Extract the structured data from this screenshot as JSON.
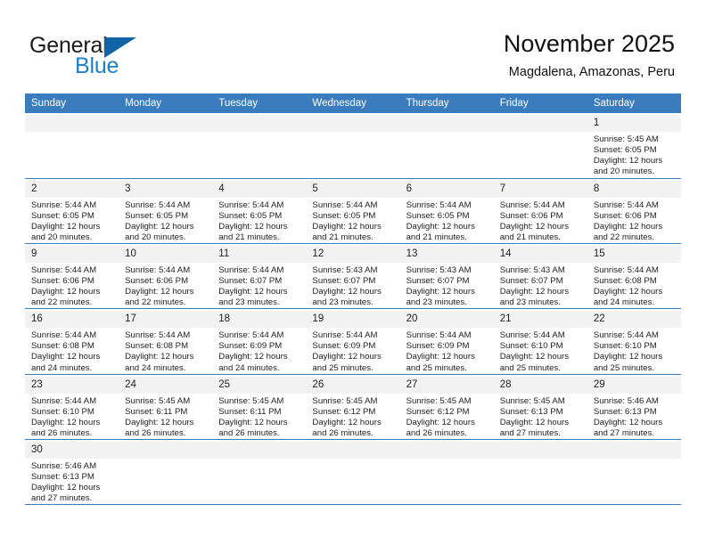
{
  "brand": {
    "name_part1": "General",
    "name_part2": "Blue",
    "triangle_color": "#1063a5",
    "blue_color": "#1e7ec8"
  },
  "header": {
    "month_title": "November 2025",
    "location": "Magdalena, Amazonas, Peru"
  },
  "theme": {
    "header_blue": "#3a7cbe",
    "cell_shade": "#f2f2f2"
  },
  "weekdays": [
    "Sunday",
    "Monday",
    "Tuesday",
    "Wednesday",
    "Thursday",
    "Friday",
    "Saturday"
  ],
  "weeks": [
    [
      {
        "day": "",
        "lines": []
      },
      {
        "day": "",
        "lines": []
      },
      {
        "day": "",
        "lines": []
      },
      {
        "day": "",
        "lines": []
      },
      {
        "day": "",
        "lines": []
      },
      {
        "day": "",
        "lines": []
      },
      {
        "day": "1",
        "lines": [
          "Sunrise: 5:45 AM",
          "Sunset: 6:05 PM",
          "Daylight: 12 hours",
          "and 20 minutes."
        ]
      }
    ],
    [
      {
        "day": "2",
        "lines": [
          "Sunrise: 5:44 AM",
          "Sunset: 6:05 PM",
          "Daylight: 12 hours",
          "and 20 minutes."
        ]
      },
      {
        "day": "3",
        "lines": [
          "Sunrise: 5:44 AM",
          "Sunset: 6:05 PM",
          "Daylight: 12 hours",
          "and 20 minutes."
        ]
      },
      {
        "day": "4",
        "lines": [
          "Sunrise: 5:44 AM",
          "Sunset: 6:05 PM",
          "Daylight: 12 hours",
          "and 21 minutes."
        ]
      },
      {
        "day": "5",
        "lines": [
          "Sunrise: 5:44 AM",
          "Sunset: 6:05 PM",
          "Daylight: 12 hours",
          "and 21 minutes."
        ]
      },
      {
        "day": "6",
        "lines": [
          "Sunrise: 5:44 AM",
          "Sunset: 6:05 PM",
          "Daylight: 12 hours",
          "and 21 minutes."
        ]
      },
      {
        "day": "7",
        "lines": [
          "Sunrise: 5:44 AM",
          "Sunset: 6:06 PM",
          "Daylight: 12 hours",
          "and 21 minutes."
        ]
      },
      {
        "day": "8",
        "lines": [
          "Sunrise: 5:44 AM",
          "Sunset: 6:06 PM",
          "Daylight: 12 hours",
          "and 22 minutes."
        ]
      }
    ],
    [
      {
        "day": "9",
        "lines": [
          "Sunrise: 5:44 AM",
          "Sunset: 6:06 PM",
          "Daylight: 12 hours",
          "and 22 minutes."
        ]
      },
      {
        "day": "10",
        "lines": [
          "Sunrise: 5:44 AM",
          "Sunset: 6:06 PM",
          "Daylight: 12 hours",
          "and 22 minutes."
        ]
      },
      {
        "day": "11",
        "lines": [
          "Sunrise: 5:44 AM",
          "Sunset: 6:07 PM",
          "Daylight: 12 hours",
          "and 23 minutes."
        ]
      },
      {
        "day": "12",
        "lines": [
          "Sunrise: 5:43 AM",
          "Sunset: 6:07 PM",
          "Daylight: 12 hours",
          "and 23 minutes."
        ]
      },
      {
        "day": "13",
        "lines": [
          "Sunrise: 5:43 AM",
          "Sunset: 6:07 PM",
          "Daylight: 12 hours",
          "and 23 minutes."
        ]
      },
      {
        "day": "14",
        "lines": [
          "Sunrise: 5:43 AM",
          "Sunset: 6:07 PM",
          "Daylight: 12 hours",
          "and 23 minutes."
        ]
      },
      {
        "day": "15",
        "lines": [
          "Sunrise: 5:44 AM",
          "Sunset: 6:08 PM",
          "Daylight: 12 hours",
          "and 24 minutes."
        ]
      }
    ],
    [
      {
        "day": "16",
        "lines": [
          "Sunrise: 5:44 AM",
          "Sunset: 6:08 PM",
          "Daylight: 12 hours",
          "and 24 minutes."
        ]
      },
      {
        "day": "17",
        "lines": [
          "Sunrise: 5:44 AM",
          "Sunset: 6:08 PM",
          "Daylight: 12 hours",
          "and 24 minutes."
        ]
      },
      {
        "day": "18",
        "lines": [
          "Sunrise: 5:44 AM",
          "Sunset: 6:09 PM",
          "Daylight: 12 hours",
          "and 24 minutes."
        ]
      },
      {
        "day": "19",
        "lines": [
          "Sunrise: 5:44 AM",
          "Sunset: 6:09 PM",
          "Daylight: 12 hours",
          "and 25 minutes."
        ]
      },
      {
        "day": "20",
        "lines": [
          "Sunrise: 5:44 AM",
          "Sunset: 6:09 PM",
          "Daylight: 12 hours",
          "and 25 minutes."
        ]
      },
      {
        "day": "21",
        "lines": [
          "Sunrise: 5:44 AM",
          "Sunset: 6:10 PM",
          "Daylight: 12 hours",
          "and 25 minutes."
        ]
      },
      {
        "day": "22",
        "lines": [
          "Sunrise: 5:44 AM",
          "Sunset: 6:10 PM",
          "Daylight: 12 hours",
          "and 25 minutes."
        ]
      }
    ],
    [
      {
        "day": "23",
        "lines": [
          "Sunrise: 5:44 AM",
          "Sunset: 6:10 PM",
          "Daylight: 12 hours",
          "and 26 minutes."
        ]
      },
      {
        "day": "24",
        "lines": [
          "Sunrise: 5:45 AM",
          "Sunset: 6:11 PM",
          "Daylight: 12 hours",
          "and 26 minutes."
        ]
      },
      {
        "day": "25",
        "lines": [
          "Sunrise: 5:45 AM",
          "Sunset: 6:11 PM",
          "Daylight: 12 hours",
          "and 26 minutes."
        ]
      },
      {
        "day": "26",
        "lines": [
          "Sunrise: 5:45 AM",
          "Sunset: 6:12 PM",
          "Daylight: 12 hours",
          "and 26 minutes."
        ]
      },
      {
        "day": "27",
        "lines": [
          "Sunrise: 5:45 AM",
          "Sunset: 6:12 PM",
          "Daylight: 12 hours",
          "and 26 minutes."
        ]
      },
      {
        "day": "28",
        "lines": [
          "Sunrise: 5:45 AM",
          "Sunset: 6:13 PM",
          "Daylight: 12 hours",
          "and 27 minutes."
        ]
      },
      {
        "day": "29",
        "lines": [
          "Sunrise: 5:46 AM",
          "Sunset: 6:13 PM",
          "Daylight: 12 hours",
          "and 27 minutes."
        ]
      }
    ],
    [
      {
        "day": "30",
        "lines": [
          "Sunrise: 5:46 AM",
          "Sunset: 6:13 PM",
          "Daylight: 12 hours",
          "and 27 minutes."
        ]
      },
      {
        "day": "",
        "lines": []
      },
      {
        "day": "",
        "lines": []
      },
      {
        "day": "",
        "lines": []
      },
      {
        "day": "",
        "lines": []
      },
      {
        "day": "",
        "lines": []
      },
      {
        "day": "",
        "lines": []
      }
    ]
  ]
}
